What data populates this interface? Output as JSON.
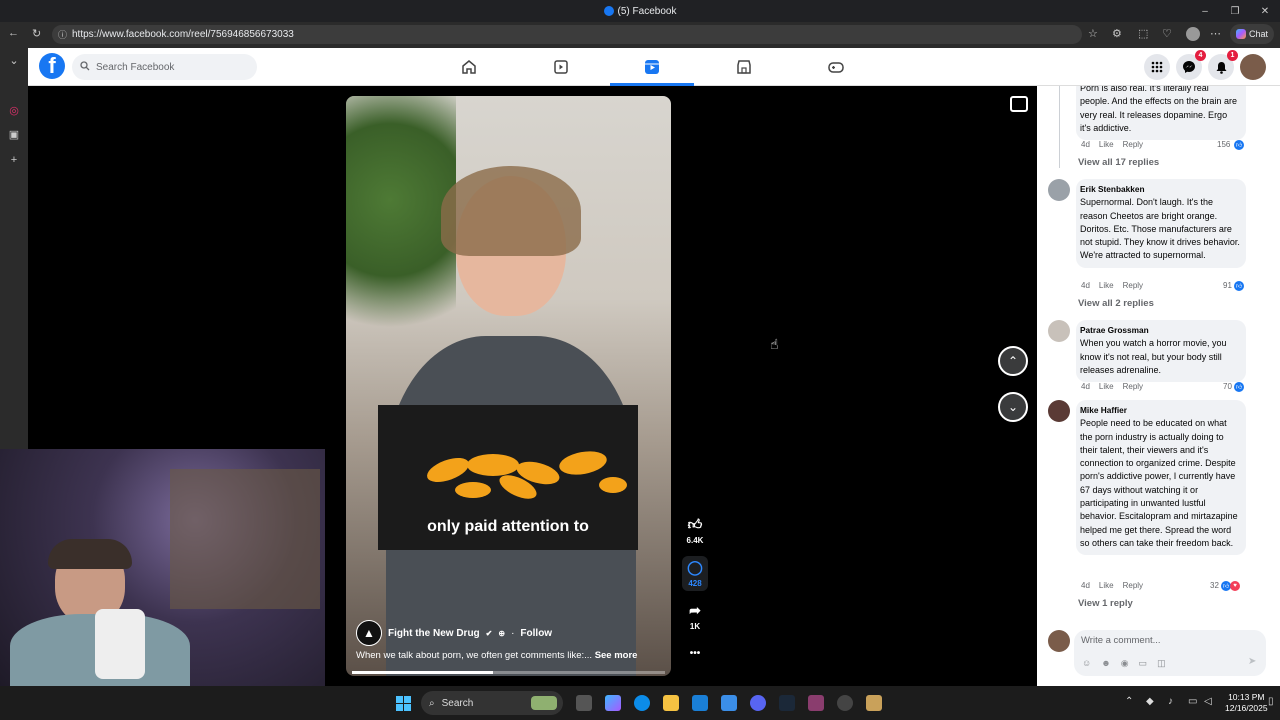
{
  "window": {
    "title": "(5) Facebook",
    "min": "–",
    "max": "❐",
    "close": "✕"
  },
  "browser": {
    "url": "https://www.facebook.com/reel/756946856673033",
    "chat_label": "Chat"
  },
  "facebook": {
    "logo": "f",
    "search_placeholder": "Search Facebook",
    "nav": [
      {
        "name": "home",
        "icon": "home-icon"
      },
      {
        "name": "video",
        "icon": "video-icon"
      },
      {
        "name": "reels",
        "icon": "reels-icon",
        "active": true
      },
      {
        "name": "marketplace",
        "icon": "marketplace-icon"
      },
      {
        "name": "gaming",
        "icon": "gaming-icon"
      }
    ],
    "messenger_badge": "4",
    "notifications_badge": "1"
  },
  "reel": {
    "caption": "only paid attention to",
    "author": "Fight the New Drug",
    "follow_label": "Follow",
    "separator": "·",
    "description": "When we talk about porn, we often get comments like:...",
    "see_more": "See more",
    "likes": "6.4K",
    "comments": "428",
    "shares": "1K",
    "more": "•••",
    "progress": 0.45
  },
  "comments": [
    {
      "name": "",
      "text": "Porn is also real. It's literally real people. And the effects on the brain are very real. It releases dopamine. Ergo it's addictive.",
      "age": "4d",
      "like": "Like",
      "reply": "Reply",
      "count": "156",
      "view_replies": "View all 17 replies"
    },
    {
      "name": "Erik Stenbakken",
      "text": "Supernormal. Don't laugh. It's the reason Cheetos are bright orange. Doritos. Etc. Those manufacturers are not stupid. They know it drives behavior. We're attracted to supernormal.",
      "age": "4d",
      "like": "Like",
      "reply": "Reply",
      "count": "91",
      "view_replies": "View all 2 replies"
    },
    {
      "name": "Patrae Grossman",
      "text": "When you watch a horror movie, you know it's not real, but your body still releases adrenaline.",
      "age": "4d",
      "like": "Like",
      "reply": "Reply",
      "count": "70",
      "view_replies": ""
    },
    {
      "name": "Mike Haffier",
      "text": "People need to be educated on what the porn industry is actually doing to their talent, their viewers and it's connection to organized crime. Despite porn's addictive power, I currently have 67 days without watching it or participating in unwanted lustful behavior. Escitalopram and mirtazapine helped me get there. Spread the word so others can take their freedom back.",
      "age": "4d",
      "like": "Like",
      "reply": "Reply",
      "count": "32",
      "view_replies": "View 1 reply"
    }
  ],
  "write_comment_placeholder": "Write a comment...",
  "taskbar": {
    "search": "Search",
    "time": "10:13 PM",
    "date": "12/16/2025"
  }
}
